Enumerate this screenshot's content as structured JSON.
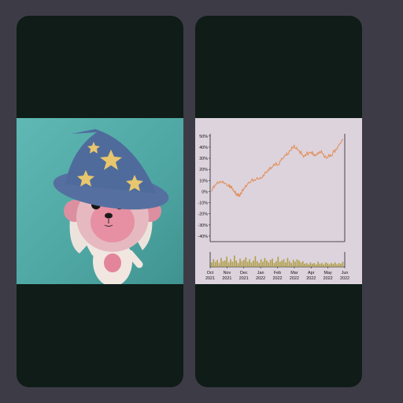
{
  "cards": [
    {
      "kind": "image",
      "subject": "3d-character-wizard-hat"
    },
    {
      "kind": "chart"
    }
  ],
  "chart_data": {
    "type": "line",
    "y_axis": {
      "ticks": [
        "50%",
        "40%",
        "30%",
        "20%",
        "10%",
        "0%",
        "-10%",
        "-20%",
        "-30%",
        "-40%"
      ],
      "ylim": [
        -45,
        52
      ]
    },
    "x_axis": {
      "ticks": [
        {
          "month": "Oct",
          "year": "2021"
        },
        {
          "month": "Nov",
          "year": "2021"
        },
        {
          "month": "Dec",
          "year": "2021"
        },
        {
          "month": "Jan",
          "year": "2022"
        },
        {
          "month": "Feb",
          "year": "2022"
        },
        {
          "month": "Mar",
          "year": "2022"
        },
        {
          "month": "Apr",
          "year": "2022"
        },
        {
          "month": "May",
          "year": "2022"
        },
        {
          "month": "Jun",
          "year": "2022"
        }
      ]
    },
    "series": [
      {
        "color": "#e0905a",
        "x": [
          "2021-10-01",
          "2021-10-10",
          "2021-10-20",
          "2021-11-01",
          "2021-11-08",
          "2021-11-15",
          "2021-11-22",
          "2021-12-01",
          "2021-12-10",
          "2021-12-20",
          "2022-01-01",
          "2022-01-10",
          "2022-01-20",
          "2022-02-01",
          "2022-02-10",
          "2022-02-20",
          "2022-03-01",
          "2022-03-10",
          "2022-03-20",
          "2022-04-01",
          "2022-04-10",
          "2022-04-20",
          "2022-05-01",
          "2022-05-10",
          "2022-05-20",
          "2022-06-01"
        ],
        "values": [
          0,
          7,
          8,
          5,
          2,
          -3,
          -4,
          3,
          8,
          10,
          12,
          17,
          22,
          24,
          30,
          34,
          40,
          37,
          31,
          35,
          32,
          35,
          30,
          32,
          38,
          47
        ]
      }
    ],
    "volume_bars": {
      "color": "#b0a04a",
      "values": [
        0.35,
        0.6,
        0.4,
        0.55,
        0.3,
        0.7,
        0.45,
        0.5,
        0.8,
        0.35,
        0.6,
        0.4,
        0.9,
        0.5,
        0.3,
        0.65,
        0.45,
        0.55,
        0.75,
        0.4,
        0.6,
        0.35,
        0.5,
        0.85,
        0.45,
        0.3,
        0.6,
        0.4,
        0.7,
        0.5,
        0.35,
        0.55,
        0.65,
        0.3,
        0.45,
        0.8,
        0.4,
        0.5,
        0.6,
        0.35,
        0.7,
        0.45,
        0.3,
        0.55,
        0.4,
        0.6,
        0.5,
        0.35,
        0.45,
        0.25,
        0.3,
        0.2,
        0.35,
        0.25,
        0.3,
        0.2,
        0.4,
        0.25,
        0.3,
        0.2,
        0.35,
        0.28,
        0.22,
        0.3,
        0.25,
        0.35,
        0.2,
        0.3,
        0.25,
        0.4
      ]
    },
    "grid": false
  }
}
